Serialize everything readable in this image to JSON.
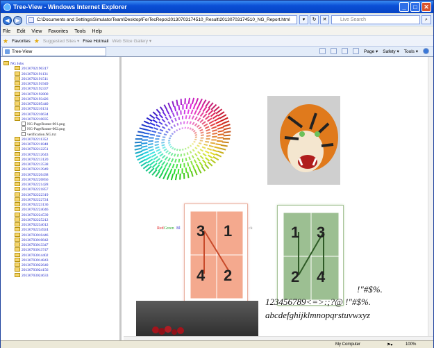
{
  "window": {
    "title": "Tree-View - Windows Internet Explorer"
  },
  "address": {
    "url": "C:\\Documents and Settings\\SimulatorTeam\\Desktop\\ForTecRepo\\20130703174510_Result\\20130703174510_NG_Report.html"
  },
  "search": {
    "placeholder": "Live Search"
  },
  "menu": [
    "File",
    "Edit",
    "View",
    "Favorites",
    "Tools",
    "Help"
  ],
  "favorites": {
    "label": "Favorites",
    "items": [
      "Suggested Sites ▾",
      "Free Hotmail",
      "Web Slice Gallery ▾"
    ]
  },
  "tab": {
    "label": "Tree-View"
  },
  "toolbar": {
    "page": "Page ▾",
    "safety": "Safety ▾",
    "tools": "Tools ▾"
  },
  "tree": {
    "root": "NG Jobs",
    "folders_a": [
      "20130702190317",
      "20130702191131",
      "20130702191511",
      "20130702191949",
      "20130702192337",
      "20130702192800",
      "20130702193426",
      "20130702205440",
      "20130702210131",
      "20130702210634",
      "20130702210835"
    ],
    "files": [
      "NG-PageRotate-001.png",
      "NG-PageRotate-002.png",
      "verification.NG.txt"
    ],
    "folders_b": [
      "20130702211352",
      "20130702211848",
      "20130702212251",
      "20130702212643",
      "20130702213120",
      "20130702213538",
      "20130702213949",
      "20130702220438",
      "20130702220856",
      "20130702221428",
      "20130702221857",
      "20130702222319",
      "20130702222724",
      "20130702223136",
      "20130702224046",
      "20130702224539",
      "20130702225212",
      "20130702234012",
      "20130702234924",
      "20130703010446",
      "20130703010842",
      "20130703013347",
      "20130703013747",
      "20130703014402",
      "20130703014843",
      "20130703022640",
      "20130703024156",
      "20130703024633"
    ]
  },
  "colors_words": [
    "Red",
    "Green",
    "Bl",
    "ck"
  ],
  "cards": {
    "salmon": {
      "n1": "3",
      "n2": "1",
      "n3": "4",
      "n4": "2",
      "color": "#f4a98e"
    },
    "green": {
      "n1": "1",
      "n2": "3",
      "n3": "2",
      "n4": "4",
      "color": "#9cbf92"
    }
  },
  "fontlines": [
    "!\"#$%.",
    "123456789<=>:;?@ !\"#$%.",
    "abcdefghijklmnopqrstuvwxyz"
  ],
  "status": {
    "zone": "My Computer",
    "zoom": "100%"
  }
}
